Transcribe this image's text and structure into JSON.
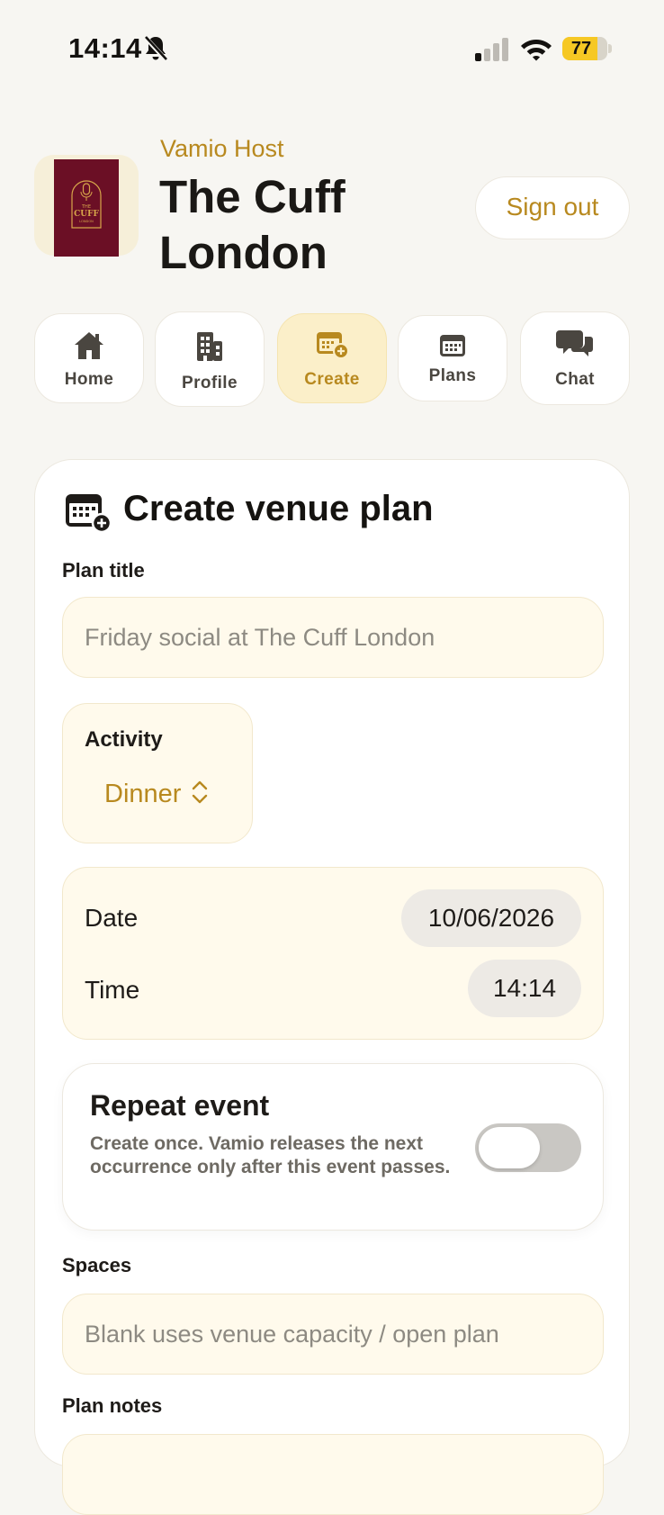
{
  "status_bar": {
    "time": "14:14",
    "battery": "77",
    "battery_level": 0.77
  },
  "header": {
    "app_name": "Vamio Host",
    "venue_name": "The Cuff London",
    "sign_out_label": "Sign out",
    "logo_text": [
      "THE",
      "CUFF",
      "LONDON"
    ]
  },
  "nav": {
    "items": [
      {
        "label": "Home",
        "icon": "home-icon"
      },
      {
        "label": "Profile",
        "icon": "building-icon"
      },
      {
        "label": "Create",
        "icon": "calendar-plus-icon",
        "active": true
      },
      {
        "label": "Plans",
        "icon": "calendar-icon"
      },
      {
        "label": "Chat",
        "icon": "chat-bubbles-icon"
      }
    ]
  },
  "form": {
    "title": "Create venue plan",
    "plan_title_label": "Plan title",
    "plan_title_placeholder": "Friday social at The Cuff London",
    "activity_label": "Activity",
    "activity_value": "Dinner",
    "date_label": "Date",
    "date_value": "10/06/2026",
    "time_label": "Time",
    "time_value": "14:14",
    "repeat_title": "Repeat event",
    "repeat_description": "Create once. Vamio releases the next occurrence only after this event passes.",
    "repeat_enabled": false,
    "spaces_label": "Spaces",
    "spaces_placeholder": "Blank uses venue capacity / open plan",
    "notes_label": "Plan notes"
  },
  "colors": {
    "accent": "#B8891F",
    "active_tab_bg": "#FBEFC9",
    "field_bg": "#FFFAEC",
    "logo_bg": "#6B0F25",
    "battery": "#F6C824"
  }
}
